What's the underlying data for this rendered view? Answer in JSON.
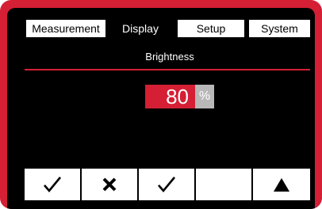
{
  "tabs": [
    {
      "label": "Measurement",
      "active": false
    },
    {
      "label": "Display",
      "active": true
    },
    {
      "label": "Setup",
      "active": false
    },
    {
      "label": "System",
      "active": false
    }
  ],
  "section": {
    "title": "Brightness"
  },
  "brightness": {
    "value": "80",
    "unit": "%"
  },
  "softkeys": [
    {
      "icon": "check-icon"
    },
    {
      "icon": "x-icon"
    },
    {
      "icon": "check-icon"
    },
    {
      "icon": "blank"
    },
    {
      "icon": "up-triangle-icon"
    }
  ],
  "colors": {
    "frame": "#d41f34",
    "screen": "#000000",
    "value_bg": "#d41f34",
    "unit_bg": "#b8b8b8"
  }
}
